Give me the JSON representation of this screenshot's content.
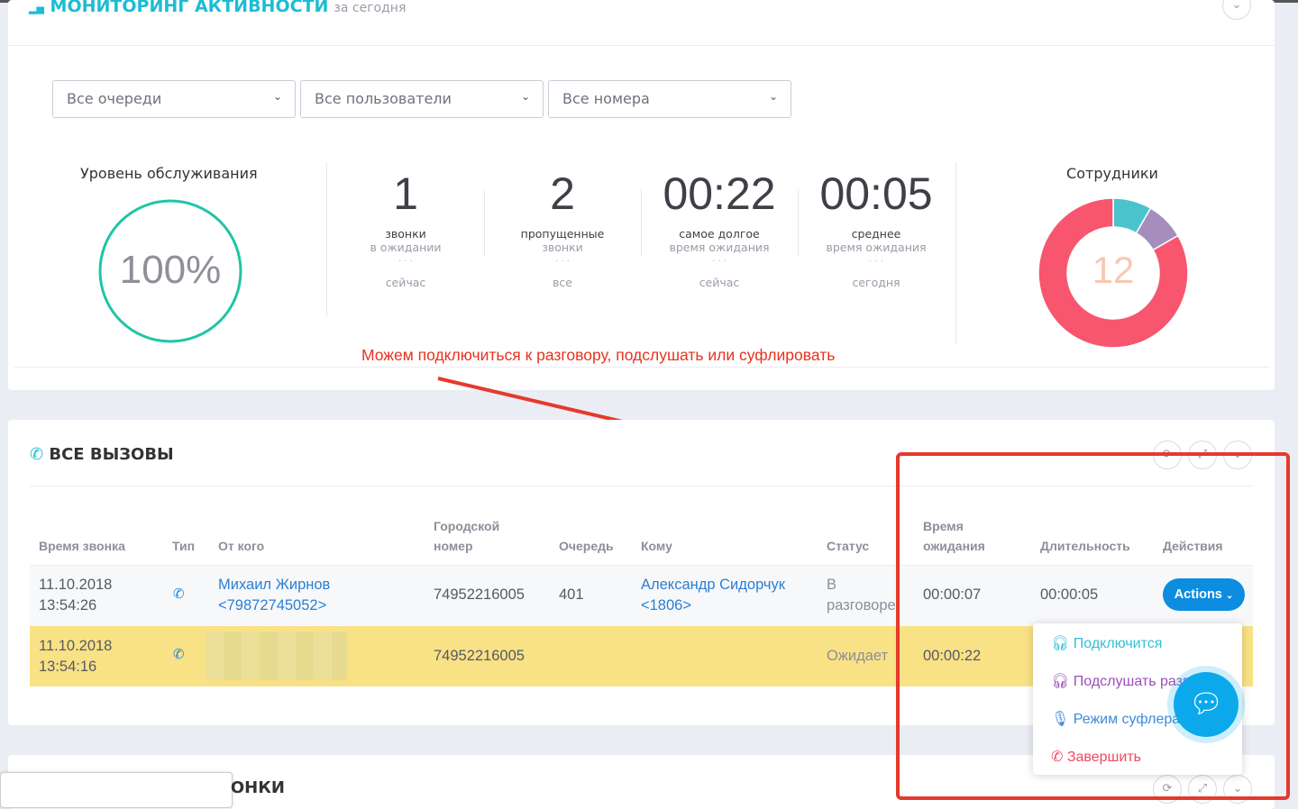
{
  "monitoring": {
    "title": "МОНИТОРИНГ АКТИВНОСТИ",
    "subtitle": "за сегодня",
    "filters": [
      "Все очереди",
      "Все пользователи",
      "Все номера"
    ],
    "service_level": {
      "label": "Уровень обслуживания",
      "value": "100%",
      "percent": 100
    },
    "stats": [
      {
        "value": "1",
        "line1": "звонки",
        "line2": "в ожидании",
        "dots": "· · ·",
        "period": "сейчас"
      },
      {
        "value": "2",
        "line1": "пропущенные",
        "line2": "звонки",
        "dots": "· · ·",
        "period": "все"
      },
      {
        "value": "00:22",
        "line1": "самое долгое",
        "line2": "время ожидания",
        "dots": "· · ·",
        "period": "сейчас"
      },
      {
        "value": "00:05",
        "line1": "среднее",
        "line2": "время ожидания",
        "dots": "· · ·",
        "period": "сегодня"
      }
    ],
    "employees": {
      "label": "Сотрудники",
      "total": "12",
      "segments": [
        {
          "value": 1,
          "color": "#4bc3cc"
        },
        {
          "value": 1,
          "color": "#a58ebd"
        },
        {
          "value": 10,
          "color": "#f7566e"
        }
      ]
    }
  },
  "annotation": "Можем подключиться к разговору, подслушать или суфлировать",
  "calls": {
    "title": "ВСЕ ВЫЗОВЫ",
    "columns": [
      "Время звонка",
      "Тип",
      "От кого",
      "Городской номер",
      "Очередь",
      "Кому",
      "Статус",
      "Время ожидания",
      "Длительность",
      "Действия"
    ],
    "rows": [
      {
        "date": "11.10.2018",
        "time": "13:54:26",
        "from": "Михаил Жирнов",
        "from_num": "<79872745052>",
        "city": "74952216005",
        "queue": "401",
        "to": "Александр Сидорчук",
        "to_num": "<1806>",
        "status1": "В",
        "status2": "разговоре",
        "wait": "00:00:07",
        "duration": "00:00:05"
      },
      {
        "date": "11.10.2018",
        "time": "13:54:16",
        "city": "74952216005",
        "status1": "Ожидает",
        "wait": "00:00:22"
      }
    ],
    "actions_label": "Actions",
    "menu": [
      "Подключится",
      "Подслушать разговор",
      "Режим суфлера",
      "Завершить"
    ]
  },
  "next_panel_title": "ЗВОНКИ",
  "colors": {
    "accent": "#1bbdd4",
    "primary": "#0c8de0",
    "highlight_row": "#f9e185",
    "annotation": "#e53a2c"
  }
}
